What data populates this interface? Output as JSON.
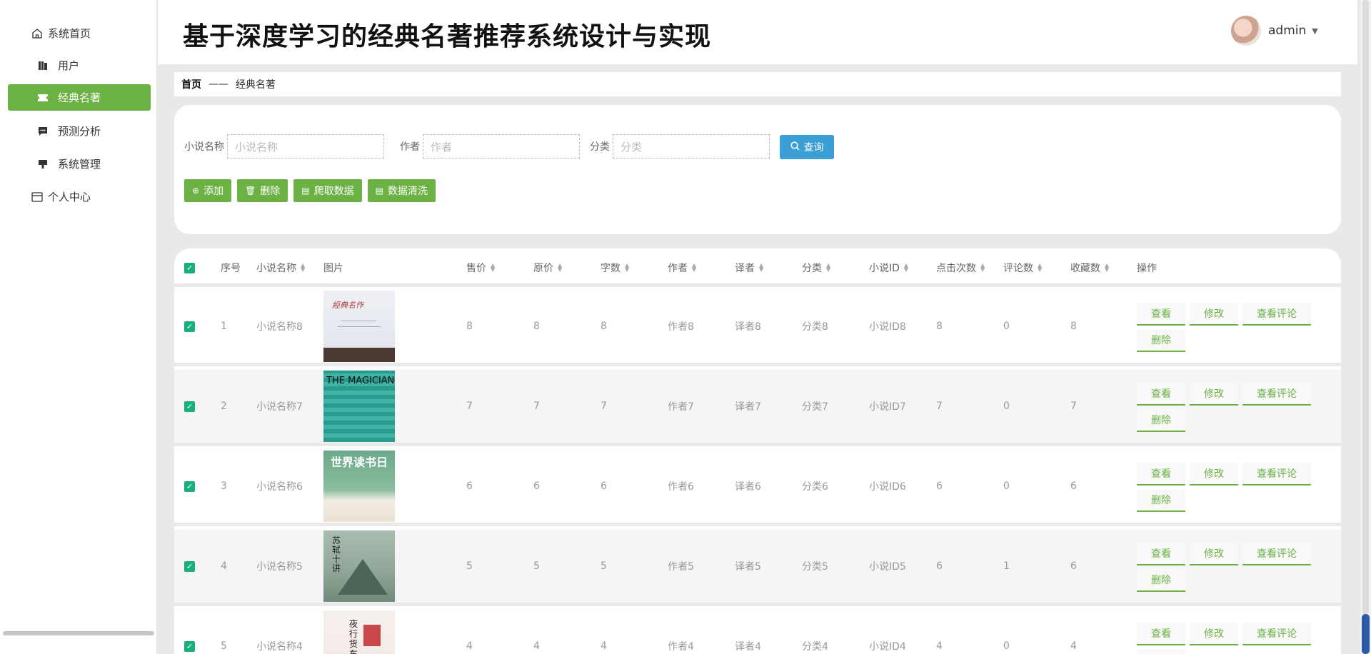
{
  "header": {
    "title": "基于深度学习的经典名著推荐系统设计与实现",
    "user": "admin"
  },
  "sidebar": {
    "items": [
      {
        "label": "系统首页",
        "icon": "home-icon"
      },
      {
        "label": "用户",
        "icon": "bookmark-icon"
      },
      {
        "label": "经典名著",
        "icon": "ticket-icon",
        "active": true
      },
      {
        "label": "预测分析",
        "icon": "chat-icon"
      },
      {
        "label": "系统管理",
        "icon": "brush-icon"
      },
      {
        "label": "个人中心",
        "icon": "card-icon"
      }
    ]
  },
  "breadcrumb": {
    "home": "首页",
    "sep": "——",
    "current": "经典名著"
  },
  "search": {
    "name_label": "小说名称",
    "name_placeholder": "小说名称",
    "author_label": "作者",
    "author_placeholder": "作者",
    "category_label": "分类",
    "category_placeholder": "分类",
    "query_label": "查询"
  },
  "actions": {
    "add": "添加",
    "delete": "删除",
    "crawl": "爬取数据",
    "clean": "数据清洗"
  },
  "table": {
    "headers": [
      "序号",
      "小说名称",
      "图片",
      "售价",
      "原价",
      "字数",
      "作者",
      "译者",
      "分类",
      "小说ID",
      "点击次数",
      "评论数",
      "收藏数",
      "操作"
    ],
    "ops": {
      "view": "查看",
      "edit": "修改",
      "comments": "查看评论",
      "delete": "删除"
    },
    "rows": [
      {
        "no": "1",
        "name": "小说名称8",
        "price": "8",
        "orig": "8",
        "words": "8",
        "author": "作者8",
        "translator": "译者8",
        "category": "分类8",
        "id": "小说ID8",
        "clicks": "8",
        "comments": "0",
        "favs": "8",
        "cover_text": "經典名作"
      },
      {
        "no": "2",
        "name": "小说名称7",
        "price": "7",
        "orig": "7",
        "words": "7",
        "author": "作者7",
        "translator": "译者7",
        "category": "分类7",
        "id": "小说ID7",
        "clicks": "7",
        "comments": "0",
        "favs": "7",
        "cover_text": "THE MAGICIAN"
      },
      {
        "no": "3",
        "name": "小说名称6",
        "price": "6",
        "orig": "6",
        "words": "6",
        "author": "作者6",
        "translator": "译者6",
        "category": "分类6",
        "id": "小说ID6",
        "clicks": "6",
        "comments": "0",
        "favs": "6",
        "cover_text": "世界读书日"
      },
      {
        "no": "4",
        "name": "小说名称5",
        "price": "5",
        "orig": "5",
        "words": "5",
        "author": "作者5",
        "translator": "译者5",
        "category": "分类5",
        "id": "小说ID5",
        "clicks": "6",
        "comments": "1",
        "favs": "6",
        "cover_text": "苏轼十讲"
      },
      {
        "no": "5",
        "name": "小说名称4",
        "price": "4",
        "orig": "4",
        "words": "4",
        "author": "作者4",
        "translator": "译者4",
        "category": "分类4",
        "id": "小说ID4",
        "clicks": "4",
        "comments": "0",
        "favs": "4",
        "cover_text": "夜行货车"
      }
    ]
  },
  "colors": {
    "accent": "#6cb144",
    "query": "#3a9fd4",
    "checkbox": "#17b07b"
  }
}
